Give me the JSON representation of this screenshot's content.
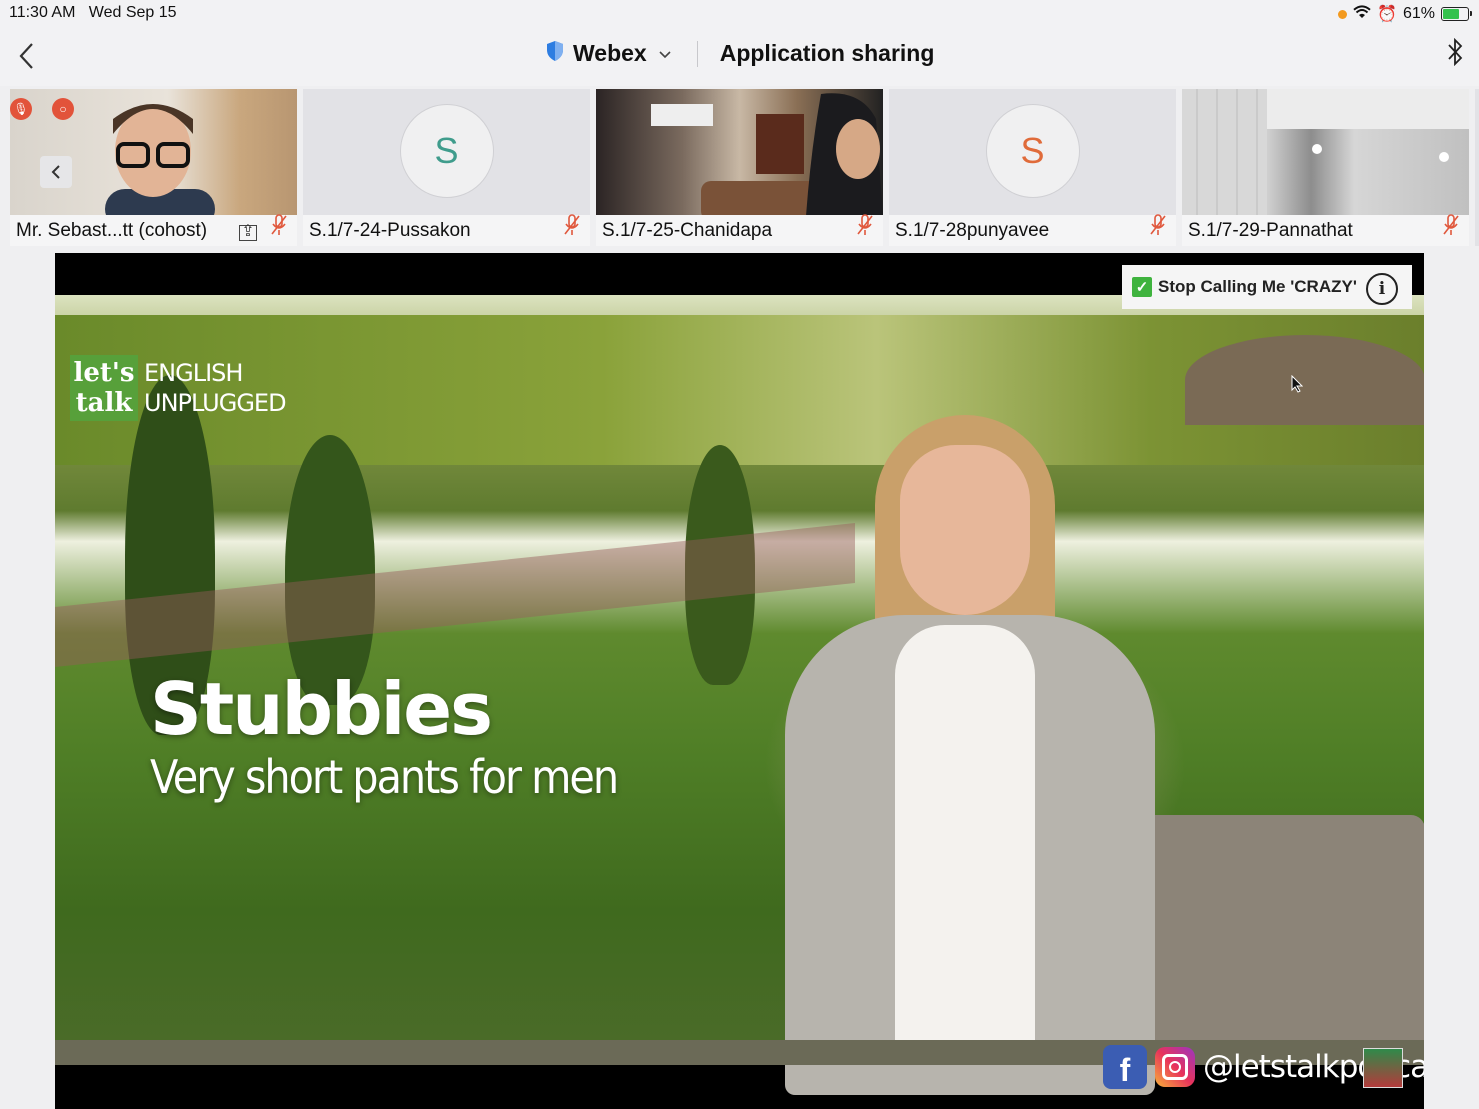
{
  "status_bar": {
    "time": "11:30 AM",
    "date": "Wed Sep 15",
    "battery": "61%",
    "icons": [
      "wifi-icon",
      "alarm-icon",
      "battery-charging-icon"
    ]
  },
  "nav": {
    "app_name": "Webex",
    "title": "Application sharing",
    "icons": [
      "back-chevron-icon",
      "shield-icon",
      "chevron-down-icon",
      "bluetooth-icon"
    ]
  },
  "participants": [
    {
      "name": "Mr. Sebast...tt (cohost)",
      "has_video": true,
      "sharing": true,
      "muted": true
    },
    {
      "name": "S.1/7-24-Pussakon",
      "has_video": false,
      "initial": "S",
      "initial_color": "#3f9c8c",
      "muted": true
    },
    {
      "name": "S.1/7-25-Chanidapa",
      "has_video": true,
      "muted": true
    },
    {
      "name": "S.1/7-28punyavee",
      "has_video": false,
      "initial": "S",
      "initial_color": "#e06b3a",
      "muted": true
    },
    {
      "name": "S.1/7-29-Pannathat",
      "has_video": true,
      "muted": true
    }
  ],
  "shared_content": {
    "video_title": "Stop Calling Me 'CRAZY'",
    "logo_line1": "let's",
    "logo_line2": "talk",
    "logo_text1": "ENGLISH",
    "logo_text2": "UNPLUGGED",
    "caption_title": "Stubbies",
    "caption_subtitle": "Very short pants for men",
    "social_handle": "@letstalkpodcast",
    "social_fb": "f"
  },
  "colors": {
    "accent_red": "#e2533a",
    "mic_muted": "#e0583d",
    "webex_shield": "#2d7de1"
  }
}
